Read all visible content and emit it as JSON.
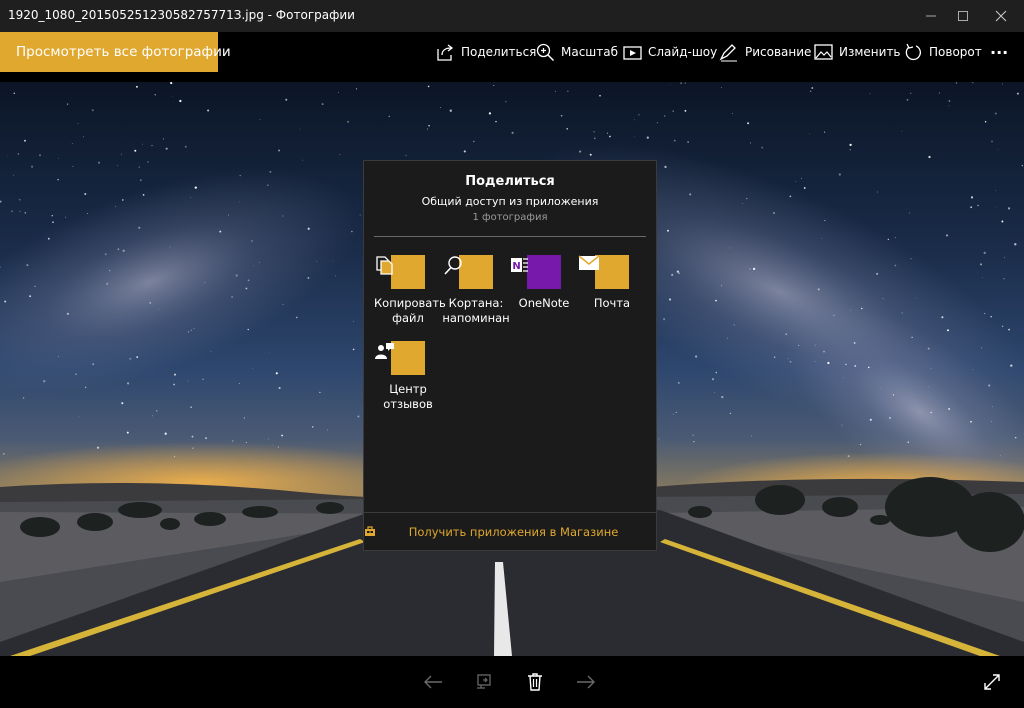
{
  "window": {
    "title": "1920_1080_20150525123058275771З.jpg - Фотографии"
  },
  "toolbar": {
    "view_all": "Просмотреть все фотографии",
    "share": "Поделиться",
    "zoom": "Масштаб",
    "slideshow": "Слайд-шоу",
    "draw": "Рисование",
    "edit": "Изменить",
    "rotate": "Поворот",
    "more": "···"
  },
  "share_panel": {
    "title": "Поделиться",
    "subtitle": "Общий доступ из приложения",
    "count": "1 фотография",
    "apps": [
      {
        "label": "Копировать\nфайл",
        "icon": "copy-file-icon",
        "color": "#e0a82e"
      },
      {
        "label": "Кортана:\nнапоминан",
        "icon": "cortana-search-icon",
        "color": "#e0a82e"
      },
      {
        "label": "OneNote",
        "icon": "onenote-icon",
        "color": "#7719aa"
      },
      {
        "label": "Почта",
        "icon": "mail-icon",
        "color": "#e0a82e"
      },
      {
        "label": "Центр\nотзывов",
        "icon": "feedback-hub-icon",
        "color": "#e0a82e"
      }
    ],
    "store_link": "Получить приложения в Магазине"
  },
  "colors": {
    "accent": "#e0a82e"
  }
}
